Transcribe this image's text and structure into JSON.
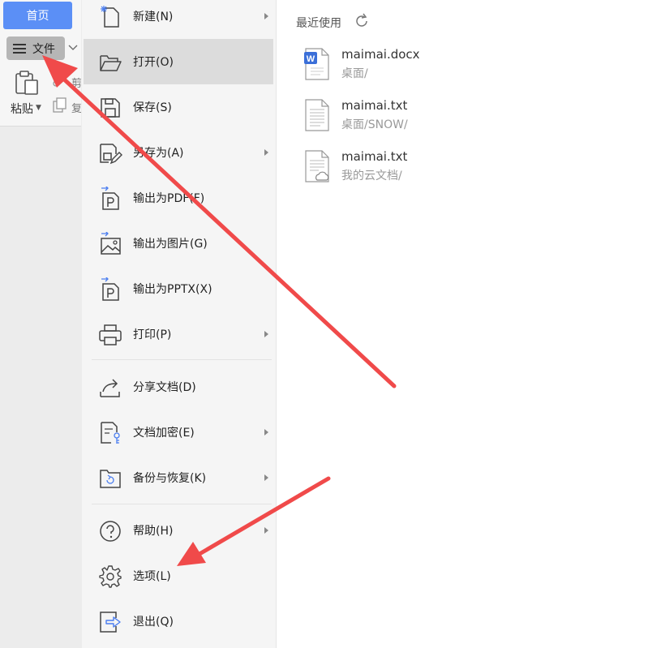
{
  "ribbon": {
    "home_tab": "首页",
    "file_label": "文件",
    "paste_label": "粘贴",
    "cut_label": "剪",
    "copy_label": "复"
  },
  "menu": {
    "items": [
      {
        "label": "新建(N)",
        "icon": "new-document-icon",
        "submenu": true
      },
      {
        "label": "打开(O)",
        "icon": "folder-open-icon",
        "submenu": false,
        "active": true
      },
      {
        "label": "保存(S)",
        "icon": "save-icon",
        "submenu": false
      },
      {
        "label": "另存为(A)",
        "icon": "save-as-icon",
        "submenu": true
      },
      {
        "label": "输出为PDF(F)",
        "icon": "export-pdf-icon",
        "submenu": false
      },
      {
        "label": "输出为图片(G)",
        "icon": "export-image-icon",
        "submenu": false
      },
      {
        "label": "输出为PPTX(X)",
        "icon": "export-pptx-icon",
        "submenu": false
      },
      {
        "label": "打印(P)",
        "icon": "printer-icon",
        "submenu": true
      },
      {
        "label": "分享文档(D)",
        "icon": "share-icon",
        "submenu": false
      },
      {
        "label": "文档加密(E)",
        "icon": "encrypt-document-icon",
        "submenu": true
      },
      {
        "label": "备份与恢复(K)",
        "icon": "backup-restore-icon",
        "submenu": true
      },
      {
        "label": "帮助(H)",
        "icon": "help-icon",
        "submenu": true
      },
      {
        "label": "选项(L)",
        "icon": "gear-icon",
        "submenu": false
      },
      {
        "label": "退出(Q)",
        "icon": "exit-icon",
        "submenu": false
      }
    ]
  },
  "recent": {
    "title": "最近使用",
    "files": [
      {
        "name": "maimai.docx",
        "path": "桌面/",
        "icon": "word-document-icon"
      },
      {
        "name": "maimai.txt",
        "path": "桌面/SNOW/",
        "icon": "text-file-icon"
      },
      {
        "name": "maimai.txt",
        "path": "我的云文档/",
        "icon": "cloud-text-file-icon"
      }
    ]
  },
  "colors": {
    "accent": "#5b8ff6",
    "annotation_arrow": "#f04a4a",
    "active_item_bg": "#dcdcdc"
  }
}
